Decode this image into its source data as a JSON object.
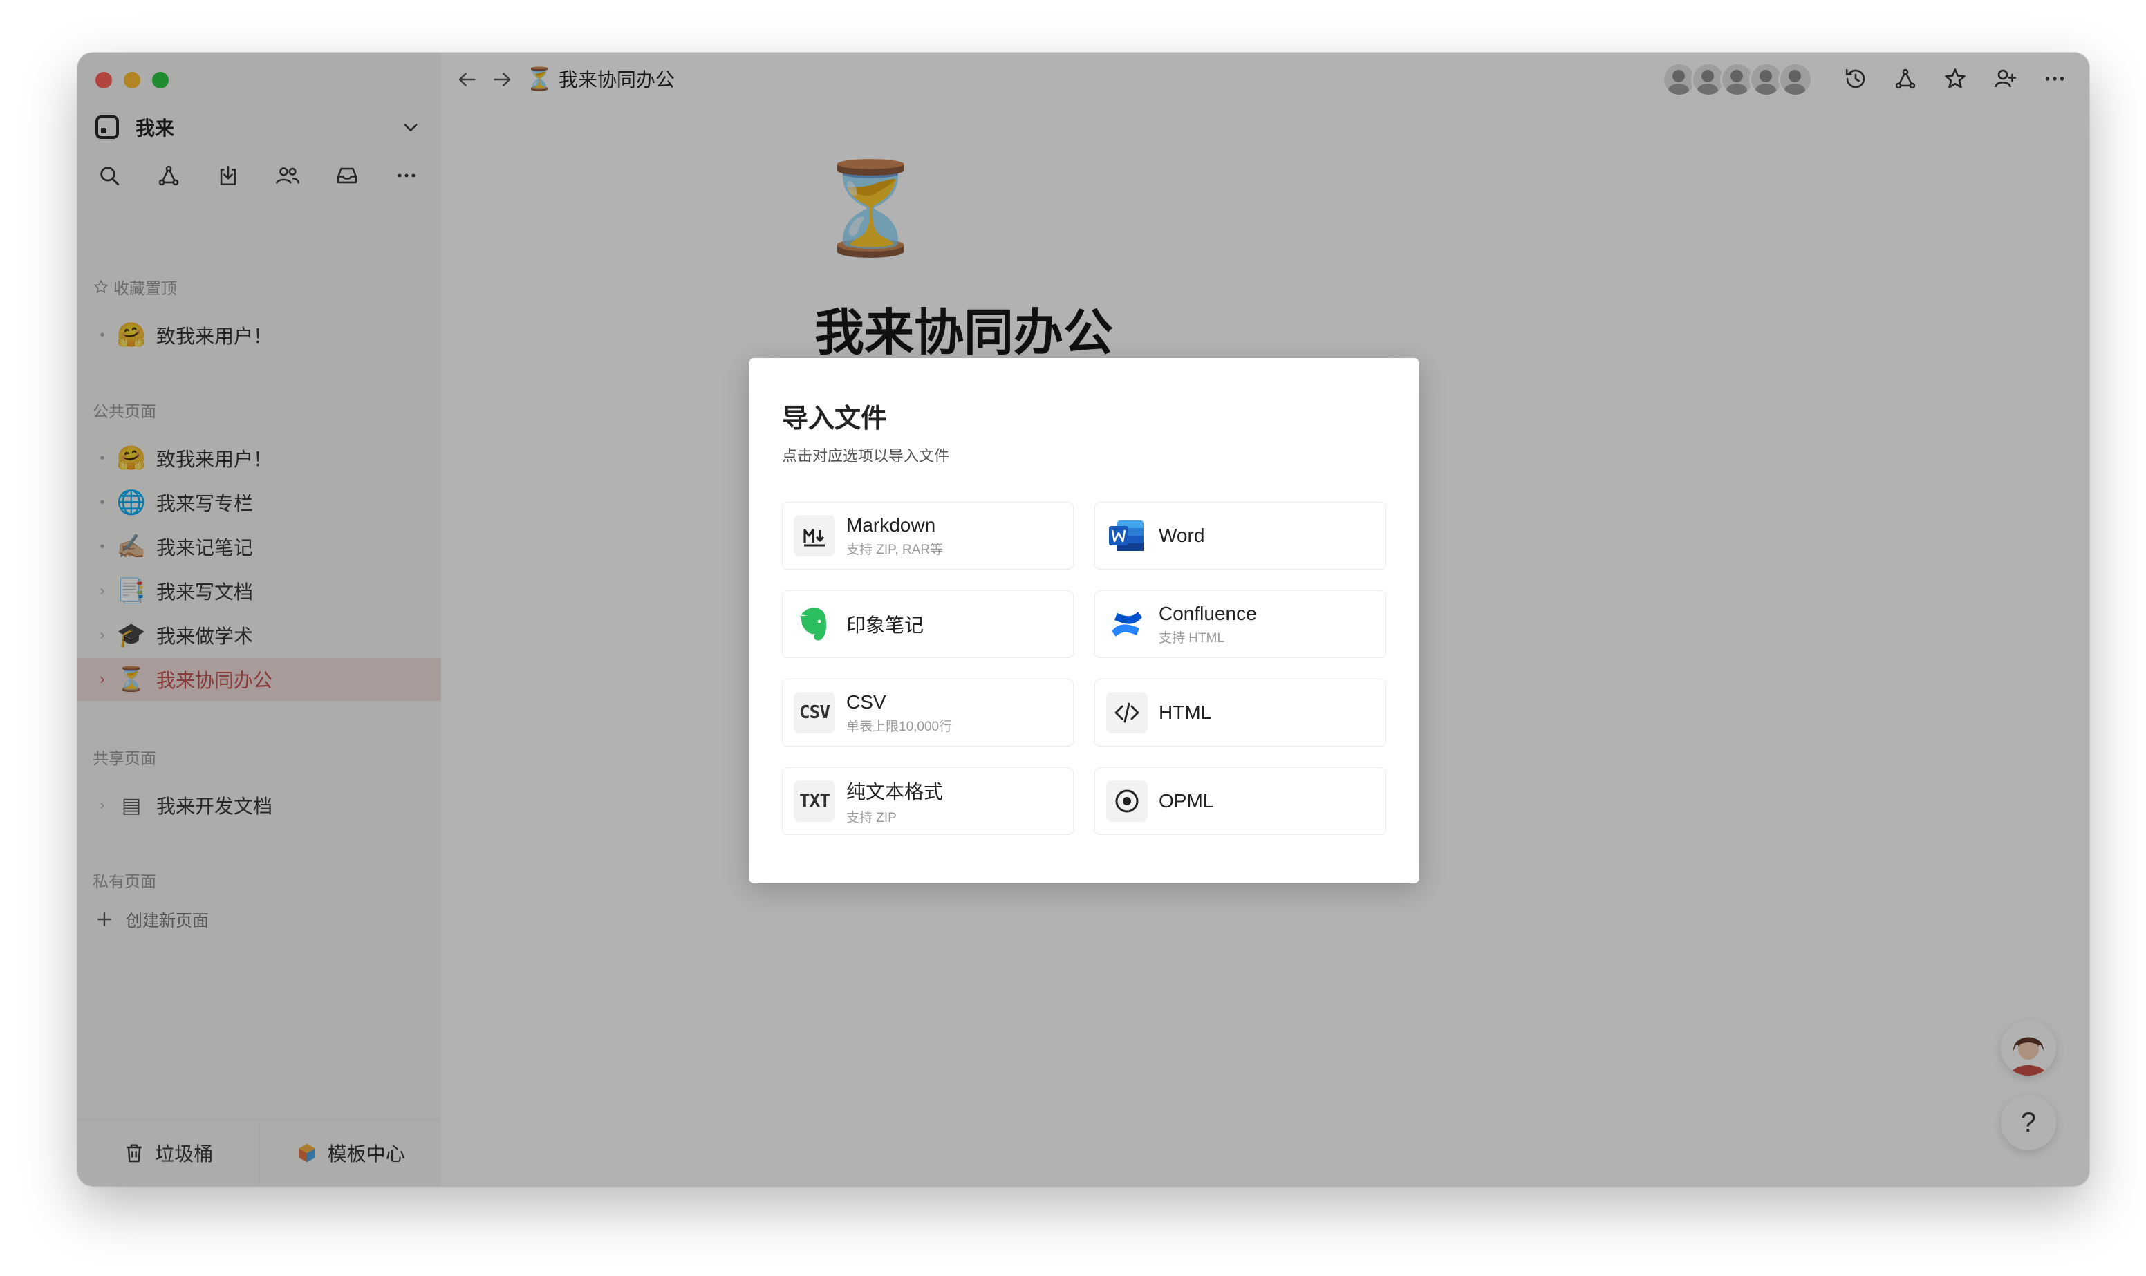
{
  "sidebar": {
    "workspace_name": "我来",
    "sections": {
      "favorites": "收藏置顶",
      "public": "公共页面",
      "shared": "共享页面",
      "private": "私有页面"
    },
    "favorites_items": [
      {
        "emoji": "🤗",
        "label": "致我来用户！"
      }
    ],
    "public_items": [
      {
        "emoji": "🤗",
        "label": "致我来用户！"
      },
      {
        "emoji": "🌐",
        "label": "我来写专栏"
      },
      {
        "emoji": "✍🏼",
        "label": "我来记笔记"
      },
      {
        "emoji": "📑",
        "label": "我来写文档"
      },
      {
        "emoji": "🎓",
        "label": "我来做学术"
      },
      {
        "emoji": "⏳",
        "label": "我来协同办公"
      }
    ],
    "shared_items": [
      {
        "emoji": "▤",
        "label": "我来开发文档"
      }
    ],
    "create_page": "创建新页面",
    "trash": "垃圾桶",
    "templates": "模板中心"
  },
  "header": {
    "breadcrumb_emoji": "⏳",
    "breadcrumb_title": "我来协同办公"
  },
  "page": {
    "emoji": "⏳",
    "title": "我来协同办公"
  },
  "help": {
    "label": "?"
  },
  "dialog": {
    "title": "导入文件",
    "subtitle": "点击对应选项以导入文件",
    "options": [
      {
        "label": "Markdown",
        "desc": "支持 ZIP, RAR等",
        "icon": "markdown-icon"
      },
      {
        "label": "Word",
        "desc": "",
        "icon": "word-icon"
      },
      {
        "label": "印象笔记",
        "desc": "",
        "icon": "evernote-icon"
      },
      {
        "label": "Confluence",
        "desc": "支持 HTML",
        "icon": "confluence-icon"
      },
      {
        "label": "CSV",
        "desc": "单表上限10,000行",
        "icon": "csv-icon",
        "icon_text": "CSV"
      },
      {
        "label": "HTML",
        "desc": "",
        "icon": "html-icon"
      },
      {
        "label": "纯文本格式",
        "desc": "支持 ZIP",
        "icon": "txt-icon",
        "icon_text": "TXT"
      },
      {
        "label": "OPML",
        "desc": "",
        "icon": "opml-icon"
      }
    ]
  },
  "colors": {
    "active_item_bg": "#f3dedd",
    "active_item_text": "#c0504d",
    "word_blue": "#185abd",
    "evernote_green": "#2dbe60",
    "confluence_blue": "#2684ff"
  }
}
